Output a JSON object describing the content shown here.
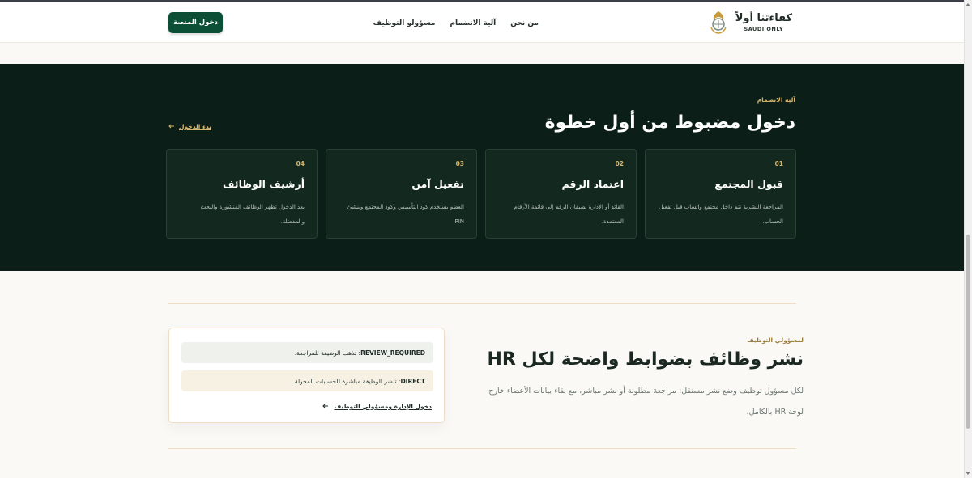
{
  "header": {
    "brand_name": "كفاءتنا أولاً",
    "brand_sub": "SAUDI ONLY",
    "nav": [
      "من نحن",
      "آلية الانضمام",
      "مسؤولو التوظيف"
    ],
    "login_button": "دخول المنصة"
  },
  "join": {
    "eyebrow": "آلية الانضمام",
    "title": "دخول مضبوط من أول خطوة",
    "start_link": "بدء الدخول",
    "steps": [
      {
        "num": "01",
        "title": "قبول المجتمع",
        "desc": "المراجعة البشرية تتم داخل مجتمع واتساب قبل تفعيل الحساب."
      },
      {
        "num": "02",
        "title": "اعتماد الرقم",
        "desc": "القائد أو الإدارة يضيفان الرقم إلى قائمة الأرقام المعتمدة."
      },
      {
        "num": "03",
        "title": "تفعيل آمن",
        "desc": "العضو يستخدم كود التأسيس وكود المجتمع وينشئ PIN."
      },
      {
        "num": "04",
        "title": "أرشيف الوظائف",
        "desc": "بعد الدخول تظهر الوظائف المنشورة والبحث والمفضلة."
      }
    ]
  },
  "hr": {
    "eyebrow": "لمسؤولي التوظيف",
    "title": "نشر وظائف بضوابط واضحة لكل HR",
    "desc": "لكل مسؤول توظيف وضع نشر مستقل: مراجعة مطلوبة أو نشر مباشر، مع بقاء بيانات الأعضاء خارج لوحة HR بالكامل.",
    "modes": [
      {
        "code": "REVIEW_REQUIRED",
        "text": ": تذهب الوظيفة للمراجعة."
      },
      {
        "code": "DIRECT",
        "text": ": تنشر الوظيفة مباشرة للحسابات المخولة."
      }
    ],
    "panel_link": "دخول الإدارة ومسؤولي التوظيف"
  },
  "colors": {
    "brand_green": "#0b4f37",
    "dark_bg": "#0b1f18",
    "gold": "#d7b66b"
  }
}
